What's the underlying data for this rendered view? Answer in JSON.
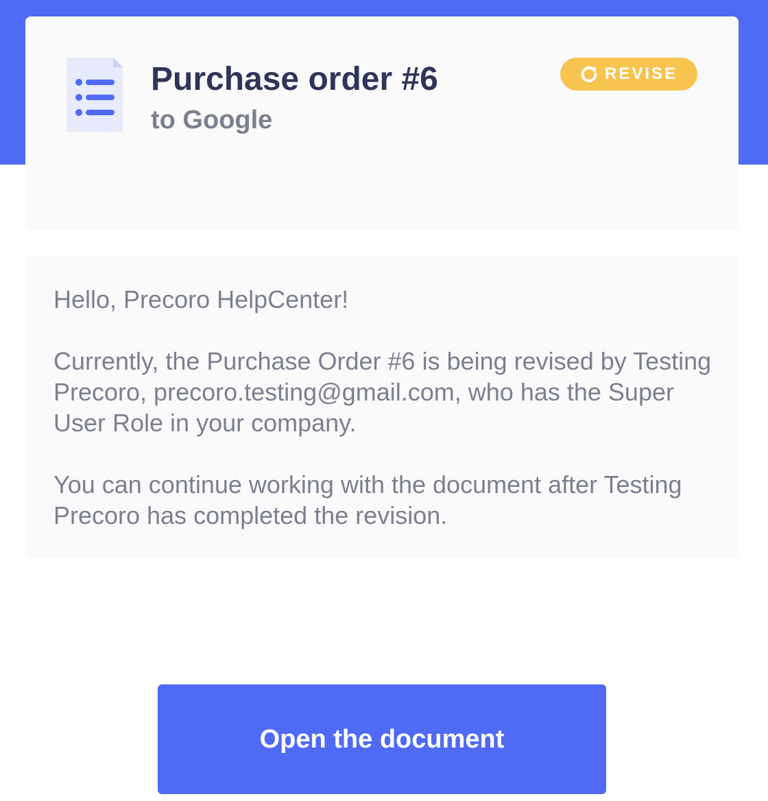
{
  "header": {
    "document_icon": "document-list-icon",
    "title": "Purchase order #6",
    "subtitle": "to Google",
    "status": {
      "icon": "refresh-icon",
      "label": "REVISE",
      "color": "#f7c44f"
    }
  },
  "message": {
    "greeting": "Hello, Precoro HelpCenter!",
    "body": "Currently, the Purchase Order #6 is being revised by Testing Precoro, precoro.testing@gmail.com, who has the Super User Role in your company.",
    "note": "You can continue working with the document after Testing Precoro has completed the revision."
  },
  "actions": {
    "open_button_label": "Open the document"
  },
  "colors": {
    "brand": "#4f6af5",
    "title_text": "#2e3559",
    "muted_text": "#7c7f8f",
    "card_background": "#fafafa"
  }
}
